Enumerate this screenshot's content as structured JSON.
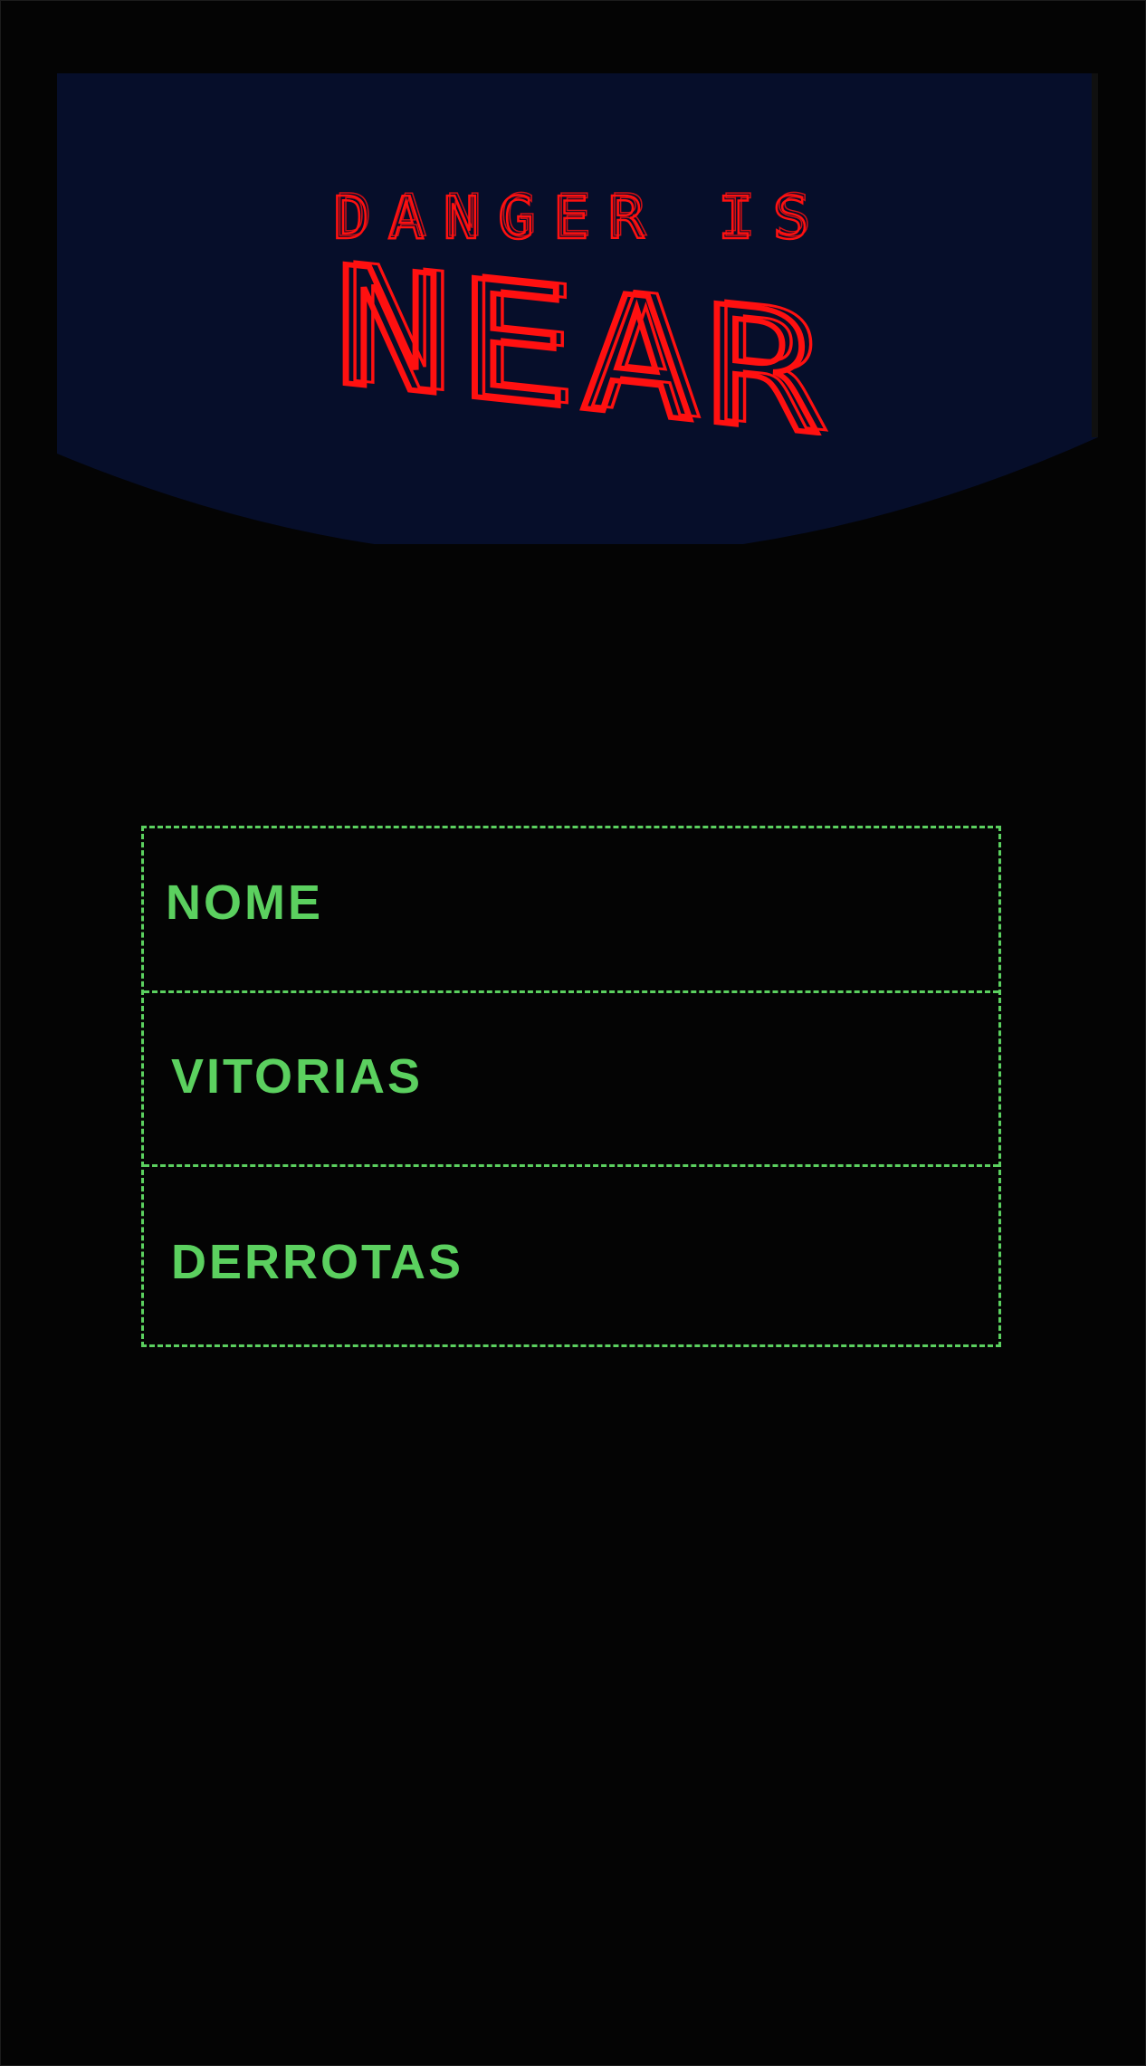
{
  "colors": {
    "background": "#040404",
    "header": "#060e2a",
    "title": "#ff1010",
    "accent": "#5bd05f"
  },
  "title": {
    "line1": "DANGER IS",
    "line2": "NEAR"
  },
  "stats": {
    "name_label": "NOME",
    "name_value": "",
    "wins_label": "VITORIAS",
    "wins_value": "",
    "losses_label": "DERROTAS",
    "losses_value": ""
  }
}
